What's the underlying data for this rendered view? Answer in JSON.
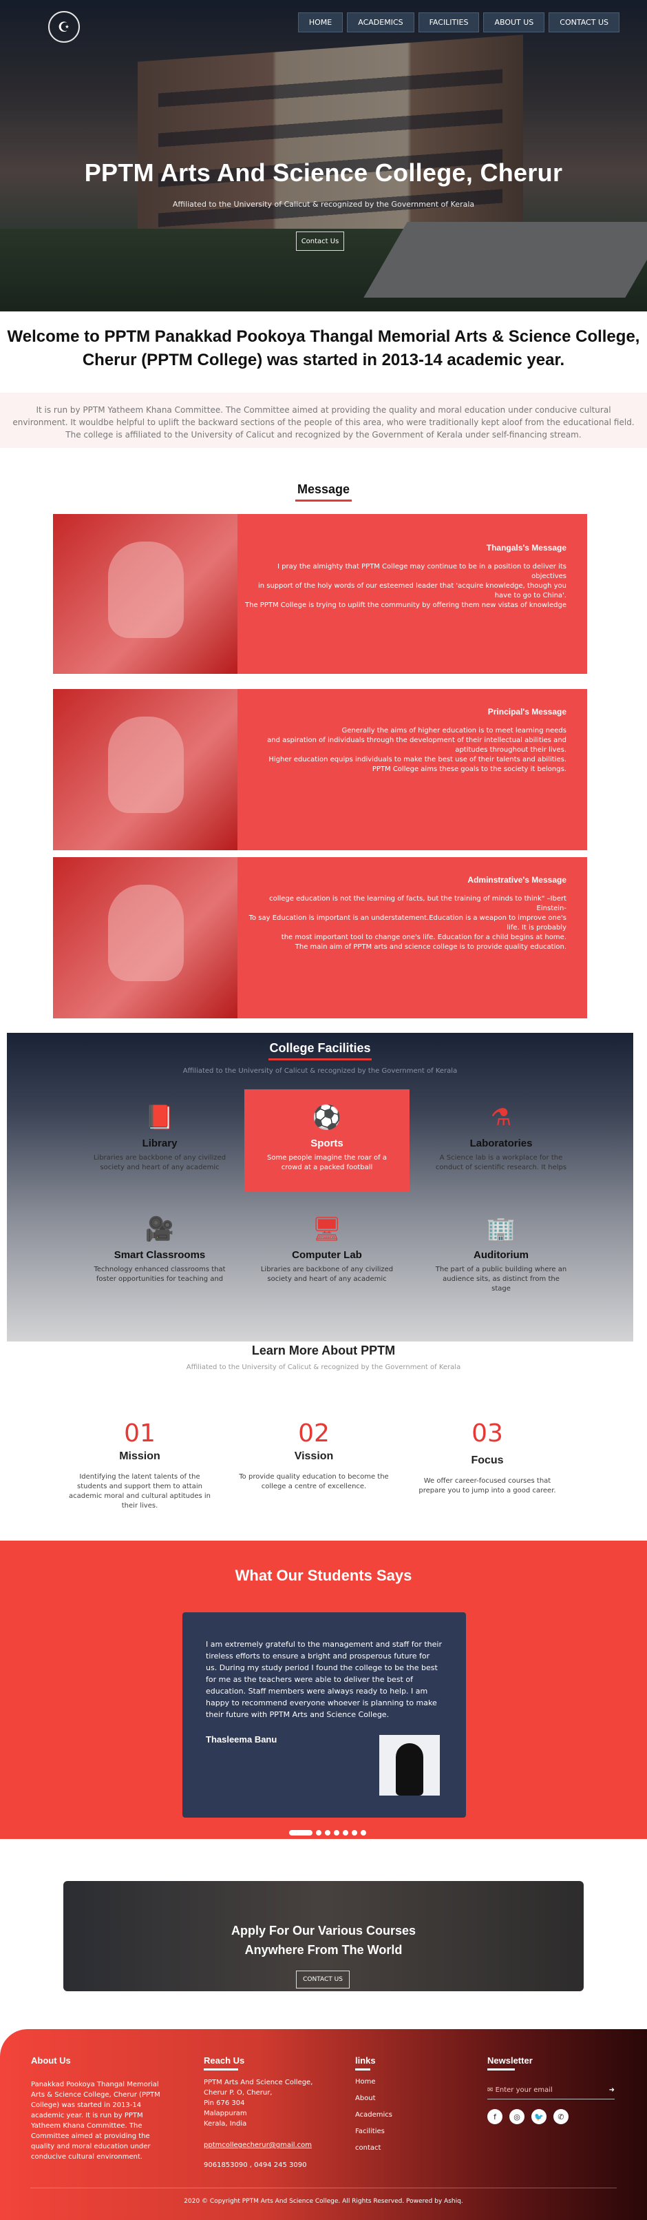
{
  "nav": [
    "HOME",
    "ACADEMICS",
    "FACILITIES",
    "ABOUT US",
    "CONTACT US"
  ],
  "hero": {
    "title": "PPTM Arts And Science College, Cherur",
    "subtitle": "Affiliated to the University of Calicut & recognized by the Government of Kerala",
    "button": "Contact Us"
  },
  "welcome": "Welcome to PPTM Panakkad Pookoya Thangal Memorial Arts & Science College, Cherur (PPTM College) was started in 2013-14 academic year.",
  "about": [
    "It is run by PPTM Yatheem Khana Committee. The Committee aimed at providing the quality and moral education under conducive cultural",
    "environment. It wouldbe helpful to uplift the backward sections of the people of this area, who were traditionally kept aloof from the educational field.",
    "The college is affiliated to the University of Calicut and recognized by the Government of Kerala under self-financing stream."
  ],
  "message_title": "Message",
  "messages": [
    {
      "title": "Thangals's Message",
      "lines": [
        "I pray the almighty that PPTM College may continue to be in a position to deliver its objectives",
        "in support of the holy words of our esteemed leader that 'acquire knowledge, though you have to go to China'.",
        "The PPTM College is trying to uplift the community by offering them new vistas of knowledge"
      ]
    },
    {
      "title": "Principal's Message",
      "lines": [
        "Generally the aims of higher education is to meet learning needs",
        "and aspiration of individuals through the development of their intellectual abilities and aptitudes throughout their lives.",
        "Higher education equips individuals to make the best use of their talents and abilities.",
        "PPTM College aims these goals to the society it belongs."
      ]
    },
    {
      "title": "Adminstrative's Message",
      "lines": [
        "college education is not the learning of facts, but the training of minds to think\" –Ibert Einstein-",
        "To say Education is important is an understatement.Education is a weapon to improve one's life. It is probably",
        "the most important tool to change one's life. Education for a child begins at home.",
        "The main aim of PPTM arts and science college is to provide quality education."
      ]
    }
  ],
  "facilities": {
    "title": "College Facilities",
    "subtitle": "Affiliated to the University of Calicut & recognized by the Government of Kerala",
    "items": [
      {
        "icon": "book-icon",
        "glyph": "📕",
        "name": "Library",
        "desc": "Libraries are backbone of any civilized society and heart of any academic"
      },
      {
        "icon": "football-icon",
        "glyph": "⚽",
        "name": "Sports",
        "desc": "Some people imagine the roar of a crowd at a packed football"
      },
      {
        "icon": "flask-icon",
        "glyph": "⚗",
        "name": "Laboratories",
        "desc": "A Science lab is a workplace for the conduct of scientific research. It helps"
      },
      {
        "icon": "video-icon",
        "glyph": "🎥",
        "name": "Smart Classrooms",
        "desc": "Technology enhanced classrooms that foster opportunities for teaching and"
      },
      {
        "icon": "desktop-icon",
        "glyph": "🖥",
        "name": "Computer Lab",
        "desc": "Libraries are backbone of any civilized society and heart of any academic"
      },
      {
        "icon": "building-icon",
        "glyph": "🏢",
        "name": "Auditorium",
        "desc": "The part of a public building where an audience sits, as distinct from the stage"
      }
    ]
  },
  "learn": {
    "title": "Learn More About PPTM",
    "subtitle": "Affiliated to the University of Calicut & recognized by the Government of Kerala",
    "items": [
      {
        "num": "01",
        "title": "Mission",
        "desc": "Identifying the latent talents of the students and support them to attain academic moral and cultural aptitudes in their lives."
      },
      {
        "num": "02",
        "title": "Vission",
        "desc": "To provide quality education to become the college a centre of excellence."
      },
      {
        "num": "03",
        "title": "Focus",
        "desc": "We offer career-focused courses that prepare you to jump into a good career."
      }
    ]
  },
  "testimonial": {
    "title": "What Our Students Says",
    "text": "I am extremely grateful to the management and staff for their tireless efforts to ensure a bright and prosperous future for us. During my study period I found the college to be the best for me as the teachers were able to deliver the best of education. Staff members were always ready to help. I am happy to recommend everyone whoever is planning to make their future with PPTM Arts and Science College.",
    "name": "Thasleema Banu"
  },
  "cta": {
    "line1": "Apply For Our Various Courses",
    "line2": "Anywhere From The World",
    "button": "CONTACT US"
  },
  "footer": {
    "about_title": "About Us",
    "about_text": "Panakkad Pookoya Thangal Memorial Arts & Science College, Cherur (PPTM College) was started in 2013-14 academic year. It is run by PPTM Yatheem Khana Committee. The Committee aimed at providing the quality and moral education under conducive cultural environment.",
    "reach_title": "Reach Us",
    "address": [
      "PPTM Arts And Science College,",
      "Cherur P. O, Cherur,",
      "Pin 676 304",
      "Malappuram",
      "Kerala, India"
    ],
    "email": "pptmcollegecherur@gmail.com",
    "phone": "9061853090 , 0494 245 3090",
    "links_title": "links",
    "links": [
      "Home",
      "About",
      "Academics",
      "Facilities",
      "contact"
    ],
    "news_title": "Newsletter",
    "news_placeholder": "Enter your email",
    "copyright": "2020 © Copyright PPTM Arts And Science College. All Rights Reserved. Powered by Ashiq."
  }
}
